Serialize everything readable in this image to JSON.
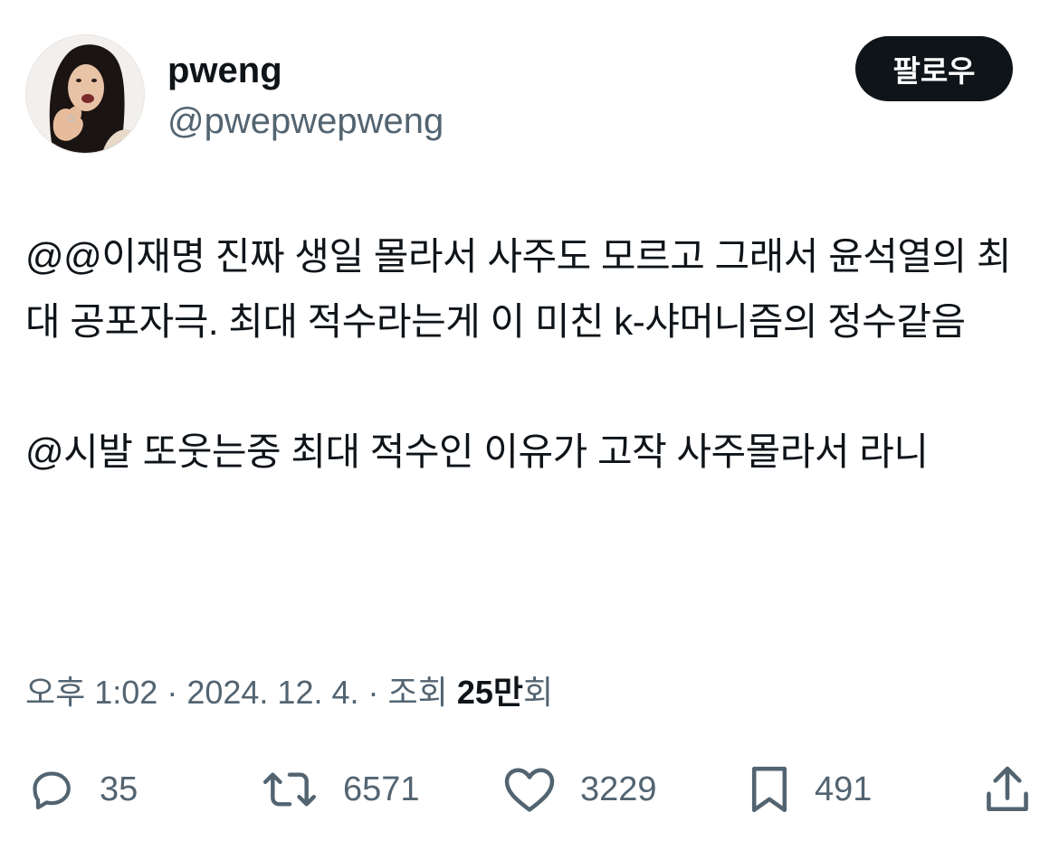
{
  "author": {
    "display_name": "pweng",
    "handle": "@pwepwepweng"
  },
  "follow_button": {
    "label": "팔로우"
  },
  "tweet": {
    "paragraphs": [
      "@@이재명 진짜 생일 몰라서 사주도 모르고 그래서 윤석열의 최대 공포자극. 최대 적수라는게 이 미친 k-샤머니즘의 정수같음",
      "@시발 또웃는중 최대 적수인 이유가 고작 사주몰라서 라니"
    ]
  },
  "meta": {
    "time": "오후 1:02",
    "separator": "·",
    "date": "2024. 12. 4.",
    "views_label": "조회",
    "views_count": "25만",
    "views_suffix": "회"
  },
  "actions": {
    "replies": "35",
    "retweets": "6571",
    "likes": "3229",
    "bookmarks": "491"
  },
  "icons": {
    "reply": "reply-icon",
    "retweet": "retweet-icon",
    "like": "heart-icon",
    "bookmark": "bookmark-icon",
    "share": "share-icon"
  },
  "colors": {
    "text": "#0f1419",
    "secondary": "#536471",
    "button_bg": "#0f1419",
    "button_text": "#ffffff"
  }
}
